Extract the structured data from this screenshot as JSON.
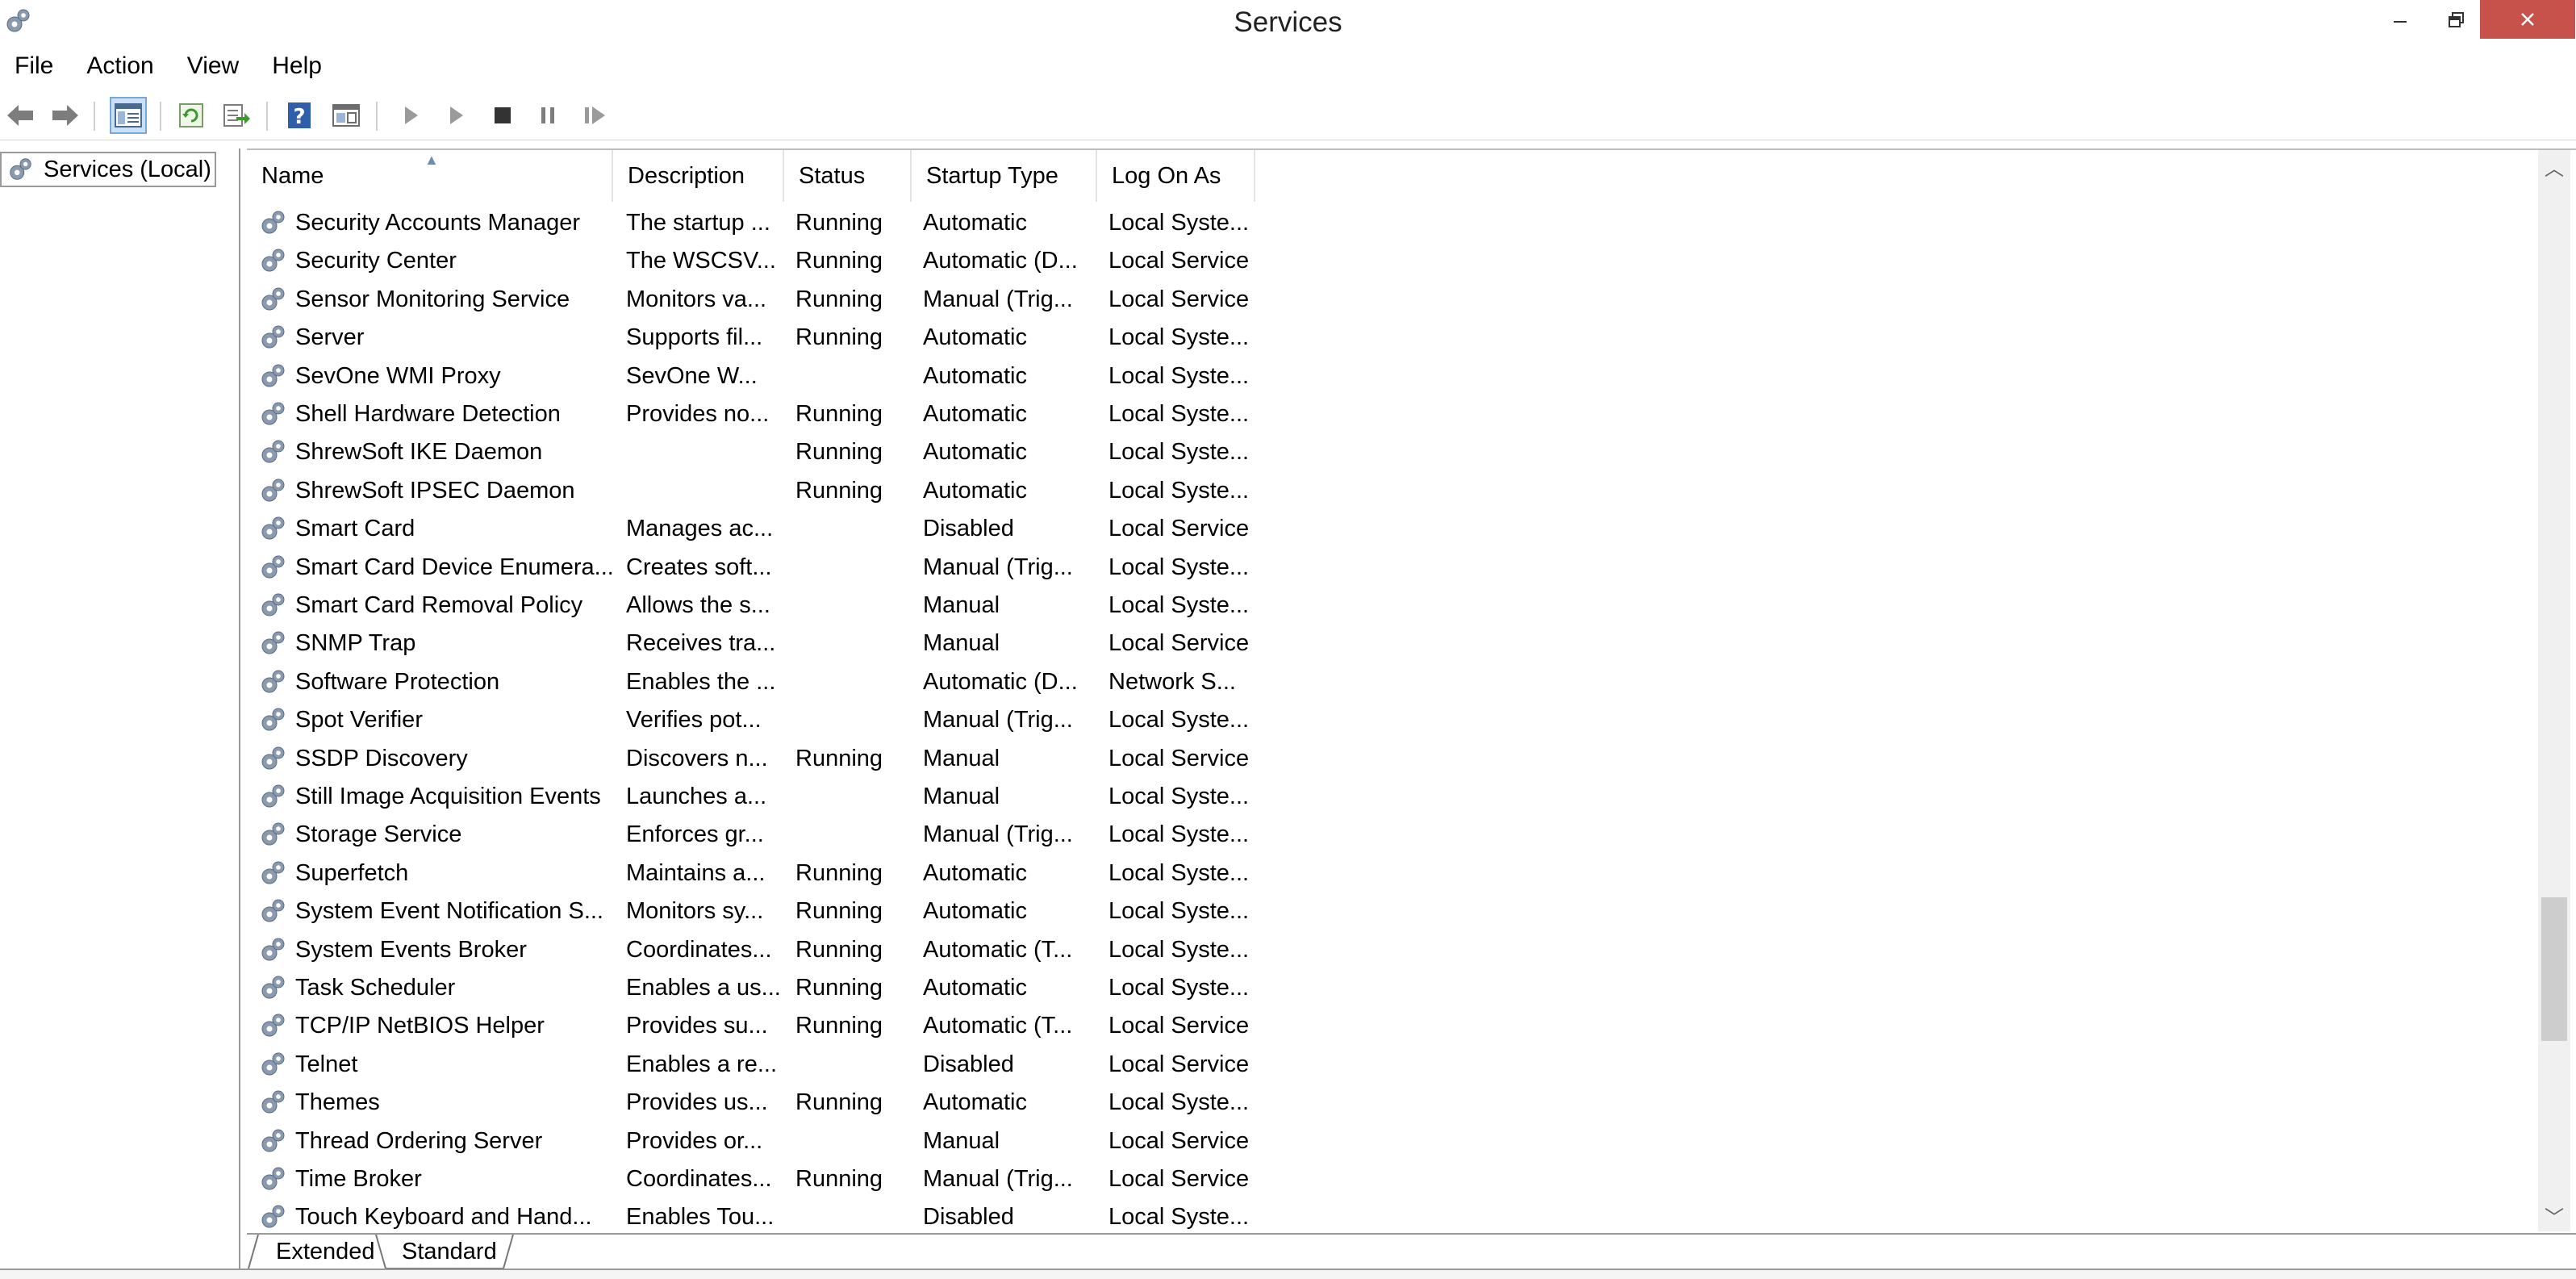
{
  "window": {
    "title": "Services",
    "icons": {
      "app": "gear-icon",
      "minimize": "minimize-icon",
      "restore": "restore-icon",
      "close": "close-icon"
    },
    "close_color": "#c7524b"
  },
  "menu": [
    "File",
    "Action",
    "View",
    "Help"
  ],
  "toolbar": {
    "icons": [
      "back-arrow-icon",
      "forward-arrow-icon",
      "show-hide-console-tree-icon",
      "refresh-icon",
      "export-list-icon",
      "help-icon",
      "properties-pane-icon",
      "start-service-icon",
      "start-service-alt-icon",
      "stop-service-icon",
      "pause-service-icon",
      "resume-service-icon"
    ]
  },
  "tree": {
    "label": "Services (Local)"
  },
  "columns": [
    "Name",
    "Description",
    "Status",
    "Startup Type",
    "Log On As"
  ],
  "rows": [
    {
      "name": "Security Accounts Manager",
      "description": "The startup ...",
      "status": "Running",
      "startup": "Automatic",
      "logon": "Local Syste..."
    },
    {
      "name": "Security Center",
      "description": "The WSCSV...",
      "status": "Running",
      "startup": "Automatic (D...",
      "logon": "Local Service"
    },
    {
      "name": "Sensor Monitoring Service",
      "description": "Monitors va...",
      "status": "Running",
      "startup": "Manual (Trig...",
      "logon": "Local Service"
    },
    {
      "name": "Server",
      "description": "Supports fil...",
      "status": "Running",
      "startup": "Automatic",
      "logon": "Local Syste..."
    },
    {
      "name": "SevOne WMI Proxy",
      "description": "SevOne W...",
      "status": "",
      "startup": "Automatic",
      "logon": "Local Syste..."
    },
    {
      "name": "Shell Hardware Detection",
      "description": "Provides no...",
      "status": "Running",
      "startup": "Automatic",
      "logon": "Local Syste..."
    },
    {
      "name": "ShrewSoft IKE Daemon",
      "description": "",
      "status": "Running",
      "startup": "Automatic",
      "logon": "Local Syste..."
    },
    {
      "name": "ShrewSoft IPSEC Daemon",
      "description": "",
      "status": "Running",
      "startup": "Automatic",
      "logon": "Local Syste..."
    },
    {
      "name": "Smart Card",
      "description": "Manages ac...",
      "status": "",
      "startup": "Disabled",
      "logon": "Local Service"
    },
    {
      "name": "Smart Card Device Enumera...",
      "description": "Creates soft...",
      "status": "",
      "startup": "Manual (Trig...",
      "logon": "Local Syste..."
    },
    {
      "name": "Smart Card Removal Policy",
      "description": "Allows the s...",
      "status": "",
      "startup": "Manual",
      "logon": "Local Syste..."
    },
    {
      "name": "SNMP Trap",
      "description": "Receives tra...",
      "status": "",
      "startup": "Manual",
      "logon": "Local Service"
    },
    {
      "name": "Software Protection",
      "description": "Enables the ...",
      "status": "",
      "startup": "Automatic (D...",
      "logon": "Network S..."
    },
    {
      "name": "Spot Verifier",
      "description": "Verifies pot...",
      "status": "",
      "startup": "Manual (Trig...",
      "logon": "Local Syste..."
    },
    {
      "name": "SSDP Discovery",
      "description": "Discovers n...",
      "status": "Running",
      "startup": "Manual",
      "logon": "Local Service"
    },
    {
      "name": "Still Image Acquisition Events",
      "description": "Launches a...",
      "status": "",
      "startup": "Manual",
      "logon": "Local Syste..."
    },
    {
      "name": "Storage Service",
      "description": "Enforces gr...",
      "status": "",
      "startup": "Manual (Trig...",
      "logon": "Local Syste..."
    },
    {
      "name": "Superfetch",
      "description": "Maintains a...",
      "status": "Running",
      "startup": "Automatic",
      "logon": "Local Syste..."
    },
    {
      "name": "System Event Notification S...",
      "description": "Monitors sy...",
      "status": "Running",
      "startup": "Automatic",
      "logon": "Local Syste..."
    },
    {
      "name": "System Events Broker",
      "description": "Coordinates...",
      "status": "Running",
      "startup": "Automatic (T...",
      "logon": "Local Syste..."
    },
    {
      "name": "Task Scheduler",
      "description": "Enables a us...",
      "status": "Running",
      "startup": "Automatic",
      "logon": "Local Syste..."
    },
    {
      "name": "TCP/IP NetBIOS Helper",
      "description": "Provides su...",
      "status": "Running",
      "startup": "Automatic (T...",
      "logon": "Local Service"
    },
    {
      "name": "Telnet",
      "description": "Enables a re...",
      "status": "",
      "startup": "Disabled",
      "logon": "Local Service"
    },
    {
      "name": "Themes",
      "description": "Provides us...",
      "status": "Running",
      "startup": "Automatic",
      "logon": "Local Syste..."
    },
    {
      "name": "Thread Ordering Server",
      "description": "Provides or...",
      "status": "",
      "startup": "Manual",
      "logon": "Local Service"
    },
    {
      "name": "Time Broker",
      "description": "Coordinates...",
      "status": "Running",
      "startup": "Manual (Trig...",
      "logon": "Local Service"
    },
    {
      "name": "Touch Keyboard and Hand...",
      "description": "Enables Tou...",
      "status": "",
      "startup": "Disabled",
      "logon": "Local Syste..."
    }
  ],
  "tabs": [
    "Extended",
    "Standard"
  ],
  "active_tab": "Standard"
}
